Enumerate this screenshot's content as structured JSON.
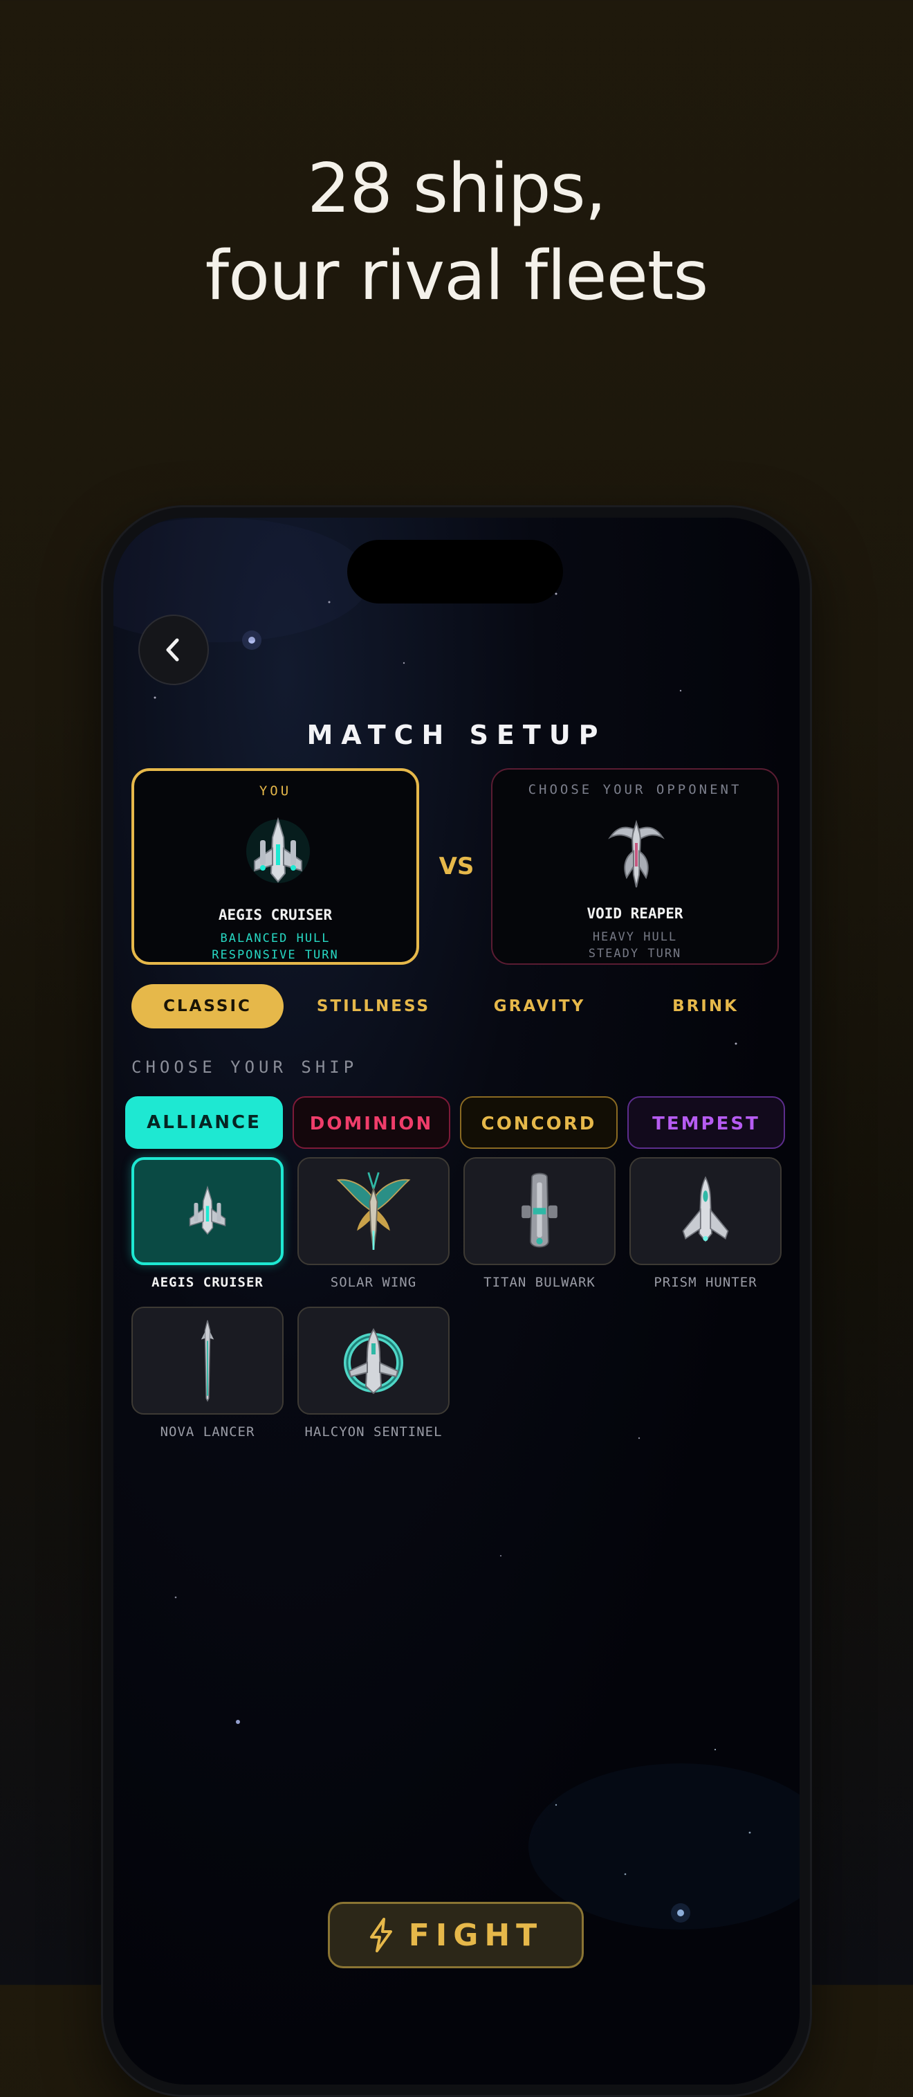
{
  "headline": {
    "line1": "28 ships,",
    "line2": "four rival fleets"
  },
  "screen": {
    "title": "MATCH SETUP",
    "player_card": {
      "tag": "YOU",
      "ship_name": "AEGIS CRUISER",
      "trait1": "BALANCED HULL",
      "trait2": "RESPONSIVE TURN",
      "icon": "aegis-cruiser-ship-icon"
    },
    "versus_label": "VS",
    "opponent_card": {
      "tag": "CHOOSE YOUR OPPONENT",
      "ship_name": "VOID REAPER",
      "trait1": "HEAVY HULL",
      "trait2": "STEADY TURN",
      "icon": "void-reaper-ship-icon"
    },
    "modes": [
      {
        "label": "CLASSIC",
        "active": true
      },
      {
        "label": "STILLNESS",
        "active": false
      },
      {
        "label": "GRAVITY",
        "active": false
      },
      {
        "label": "BRINK",
        "active": false
      }
    ],
    "choose_label": "CHOOSE YOUR SHIP",
    "factions": [
      {
        "label": "ALLIANCE",
        "active": true,
        "color": "#1ee8d2"
      },
      {
        "label": "DOMINION",
        "active": false,
        "color": "#ef3d6a"
      },
      {
        "label": "CONCORD",
        "active": false,
        "color": "#e6b84a"
      },
      {
        "label": "TEMPEST",
        "active": false,
        "color": "#b65cf2"
      }
    ],
    "ships": [
      {
        "name": "AEGIS CRUISER",
        "selected": true,
        "icon": "aegis-cruiser-icon"
      },
      {
        "name": "SOLAR WING",
        "selected": false,
        "icon": "solar-wing-icon"
      },
      {
        "name": "TITAN BULWARK",
        "selected": false,
        "icon": "titan-bulwark-icon"
      },
      {
        "name": "PRISM HUNTER",
        "selected": false,
        "icon": "prism-hunter-icon"
      },
      {
        "name": "NOVA LANCER",
        "selected": false,
        "icon": "nova-lancer-icon"
      },
      {
        "name": "HALCYON SENTINEL",
        "selected": false,
        "icon": "halcyon-sentinel-icon"
      }
    ],
    "fight_label": "FIGHT"
  },
  "colors": {
    "accent_gold": "#e6b84a",
    "accent_teal": "#1ee8d2"
  }
}
